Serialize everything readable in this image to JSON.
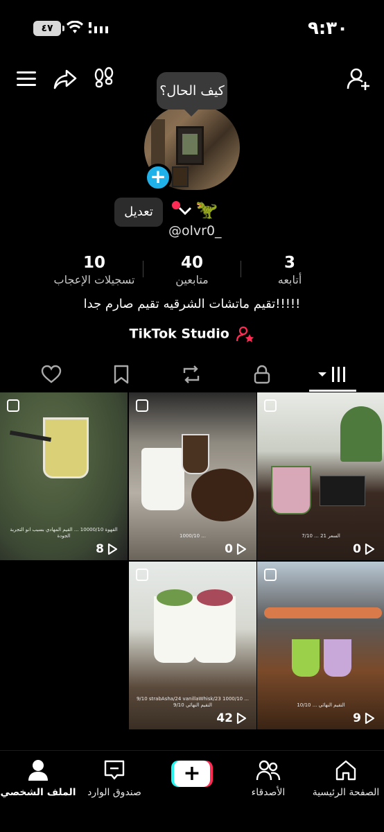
{
  "status_bar": {
    "time": "٩:٣٠",
    "battery": "٤٧"
  },
  "header": {
    "bubble_text": "كيف الحال؟"
  },
  "profile": {
    "edit_label": "تعديل",
    "username": "@olvr0_",
    "bio": "تقيم ماتشات الشرقيه تقيم صارم جدا!!!!!",
    "studio_label": "TikTok Studio"
  },
  "stats": {
    "likes": {
      "value": "10",
      "label": "تسجيلات الإعجاب"
    },
    "followers": {
      "value": "40",
      "label": "متابعين"
    },
    "following": {
      "value": "3",
      "label": "أتابعه"
    }
  },
  "videos": [
    {
      "views": "8",
      "caption": "القهوة 10000/10 ... القيم المهادي بسبب انو التجربة الجودة"
    },
    {
      "views": "0",
      "caption": "1000/10 ..."
    },
    {
      "views": "0",
      "caption": "7/10 ... السعر 21"
    },
    {
      "views": "42",
      "caption": "9/10 strabAsha/24 vanillaWhisk/23 1000/10 ... التقيم النهائي 9/10"
    },
    {
      "views": "9",
      "caption": "10/10 ... التقيم النهائي"
    }
  ],
  "nav": {
    "profile": "الملف الشخصي",
    "inbox": "صندوق الوارد",
    "create": "+",
    "friends": "الأصدقاء",
    "home": "الصفحة الرئيسية"
  },
  "colors": {
    "accent_blue": "#20b1e8",
    "tiktok_red": "#fe2c55",
    "tiktok_cyan": "#25f4ee"
  }
}
